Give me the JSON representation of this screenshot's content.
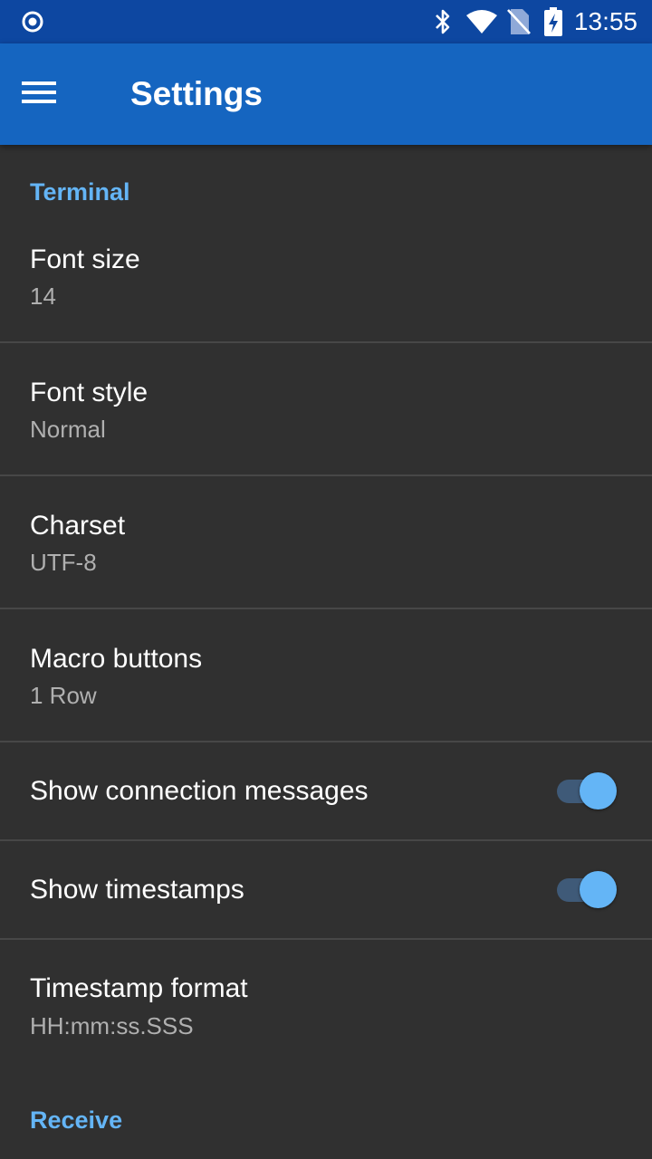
{
  "status_bar": {
    "time": "13:55",
    "icons": [
      "record-icon",
      "bluetooth-icon",
      "wifi-icon",
      "no-sim-icon",
      "battery-charging-icon"
    ]
  },
  "app_bar": {
    "title": "Settings",
    "menu_icon": "hamburger-menu-icon"
  },
  "sections": {
    "terminal": {
      "header": "Terminal",
      "font_size": {
        "title": "Font size",
        "summary": "14"
      },
      "font_style": {
        "title": "Font style",
        "summary": "Normal"
      },
      "charset": {
        "title": "Charset",
        "summary": "UTF-8"
      },
      "macro_buttons": {
        "title": "Macro buttons",
        "summary": "1 Row"
      },
      "show_connection_messages": {
        "title": "Show connection messages",
        "checked": true
      },
      "show_timestamps": {
        "title": "Show timestamps",
        "checked": true
      },
      "timestamp_format": {
        "title": "Timestamp format",
        "summary": "HH:mm:ss.SSS"
      }
    },
    "receive": {
      "header": "Receive"
    }
  },
  "colors": {
    "status_bar": "#0d47a1",
    "app_bar": "#1565c0",
    "background": "#303030",
    "accent": "#64b5f6"
  }
}
